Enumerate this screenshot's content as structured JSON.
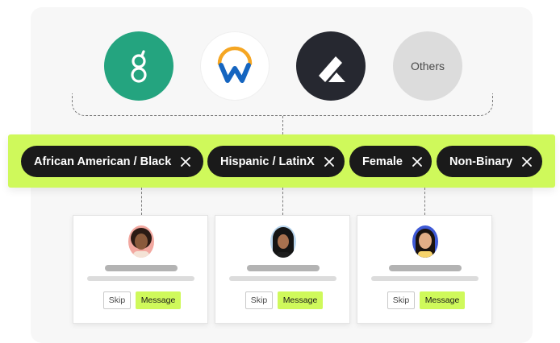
{
  "integrations": [
    {
      "name": "greenhouse",
      "icon": "greenhouse-logo-icon",
      "bg": "#24a47f"
    },
    {
      "name": "workday",
      "icon": "workday-logo-icon",
      "bg": "#ffffff"
    },
    {
      "name": "lever",
      "icon": "lever-logo-icon",
      "bg": "#262830"
    },
    {
      "name": "others",
      "label": "Others",
      "bg": "#dcdcdc"
    }
  ],
  "filters": [
    {
      "label": "African American / Black"
    },
    {
      "label": "Hispanic / LatinX"
    },
    {
      "label": "Female"
    },
    {
      "label": "Non-Binary"
    }
  ],
  "candidates": [
    {
      "avatar_bg": "#f2a8a0",
      "skip_label": "Skip",
      "message_label": "Message"
    },
    {
      "avatar_bg": "#b9d6ee",
      "skip_label": "Skip",
      "message_label": "Message"
    },
    {
      "avatar_bg": "#3f5ad6",
      "skip_label": "Skip",
      "message_label": "Message"
    }
  ],
  "colors": {
    "accent": "#cff95b",
    "chip": "#1a1a1a",
    "panel": "#f7f7f7"
  }
}
